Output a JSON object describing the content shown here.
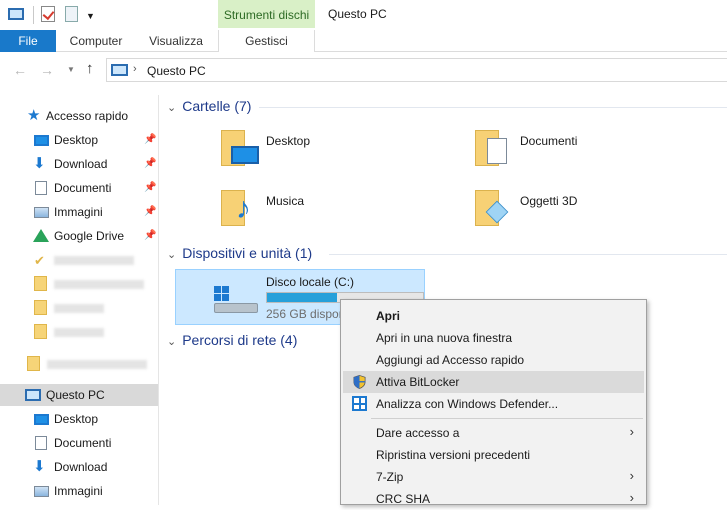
{
  "titlebar": {
    "context_tab": "Strumenti dischi",
    "window_title": "Questo PC"
  },
  "ribbon": {
    "tabs": [
      "File",
      "Computer",
      "Visualizza",
      "Gestisci"
    ]
  },
  "address": {
    "path": "Questo PC"
  },
  "sidebar": {
    "items": [
      {
        "label": "Accesso rapido",
        "icon": "star-icon"
      },
      {
        "label": "Desktop",
        "icon": "desktop-icon",
        "pinned": true
      },
      {
        "label": "Download",
        "icon": "download-icon",
        "pinned": true
      },
      {
        "label": "Documenti",
        "icon": "documents-icon",
        "pinned": true
      },
      {
        "label": "Immagini",
        "icon": "pictures-icon",
        "pinned": true
      },
      {
        "label": "Google Drive",
        "icon": "google-drive-icon",
        "pinned": true
      },
      {
        "label": "Questo PC",
        "icon": "this-pc-icon",
        "selected": true
      },
      {
        "label": "Desktop",
        "icon": "desktop-icon"
      },
      {
        "label": "Documenti",
        "icon": "documents-icon"
      },
      {
        "label": "Download",
        "icon": "download-icon"
      },
      {
        "label": "Immagini",
        "icon": "pictures-icon"
      }
    ]
  },
  "content": {
    "folders_header": "Cartelle (7)",
    "folders": [
      "Desktop",
      "Documenti",
      "Musica",
      "Oggetti 3D"
    ],
    "devices_header": "Dispositivi e unità (1)",
    "drive": {
      "name": "Disco locale (C:)",
      "free_text": "256 GB dispon",
      "usage_fraction": 0.45
    },
    "network_header": "Percorsi di rete (4)"
  },
  "context_menu": {
    "items": [
      {
        "label": "Apri",
        "bold": true
      },
      {
        "label": "Apri in una nuova finestra"
      },
      {
        "label": "Aggiungi ad Accesso rapido"
      },
      {
        "label": "Attiva BitLocker",
        "icon": "shield-icon",
        "highlighted": true
      },
      {
        "label": "Analizza con Windows Defender...",
        "icon": "windows-defender-icon"
      },
      {
        "label": "Dare accesso a",
        "submenu": true
      },
      {
        "label": "Ripristina versioni precedenti"
      },
      {
        "label": "7-Zip",
        "submenu": true
      },
      {
        "label": "CRC SHA",
        "submenu": true
      }
    ]
  },
  "colors": {
    "accent": "#1979ca",
    "context_tab_bg": "#d9f0c7",
    "drive_selected_bg": "#cce8ff",
    "menu_highlight": "#dadada"
  }
}
